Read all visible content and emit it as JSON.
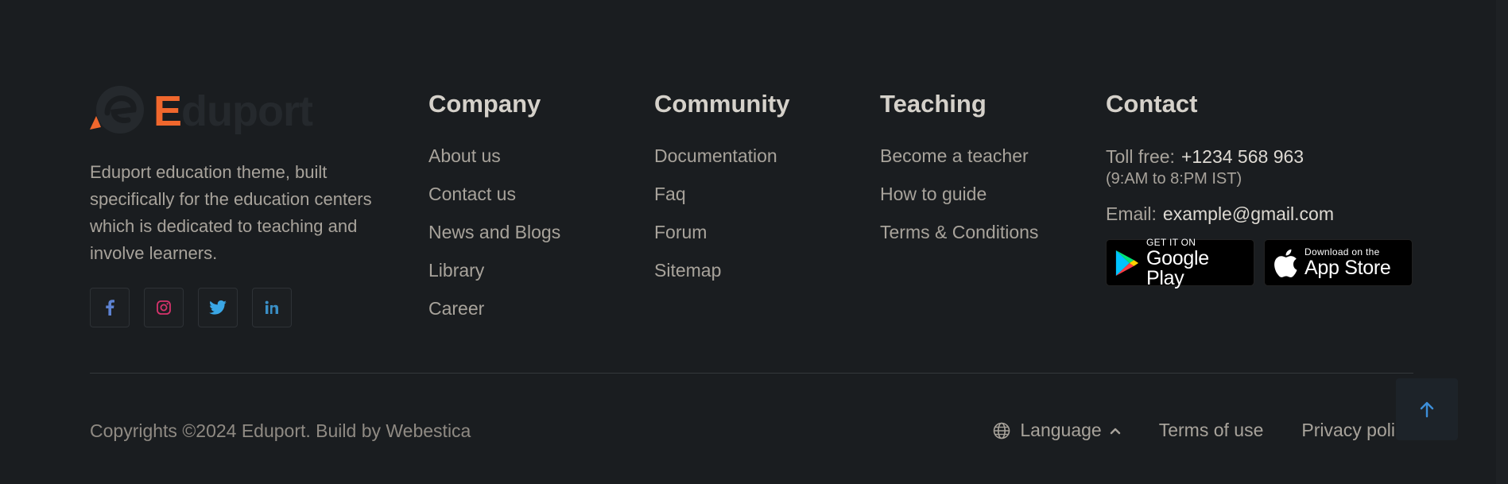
{
  "brand": {
    "logo_letter": "E",
    "logo_rest": "duport",
    "description": "Eduport education theme, built specifically for the education centers which is dedicated to teaching and involve learners.",
    "accent_color": "#f0672d"
  },
  "socials": [
    {
      "icon": "facebook-icon",
      "color": "#5d82d1"
    },
    {
      "icon": "instagram-icon",
      "color": "#d6336c"
    },
    {
      "icon": "twitter-icon",
      "color": "#3aa7e6"
    },
    {
      "icon": "linkedin-icon",
      "color": "#3a8fc6"
    }
  ],
  "company": {
    "title": "Company",
    "links": [
      "About us",
      "Contact us",
      "News and Blogs",
      "Library",
      "Career"
    ]
  },
  "community": {
    "title": "Community",
    "links": [
      "Documentation",
      "Faq",
      "Forum",
      "Sitemap"
    ]
  },
  "teaching": {
    "title": "Teaching",
    "links": [
      "Become a teacher",
      "How to guide",
      "Terms & Conditions"
    ]
  },
  "contact": {
    "title": "Contact",
    "toll_label": "Toll free:",
    "toll_value": "+1234 568 963",
    "hours": "(9:AM to 8:PM IST)",
    "email_label": "Email:",
    "email_value": "example@gmail.com",
    "google_small": "GET IT ON",
    "google_big": "Google Play",
    "apple_small": "Download on the",
    "apple_big": "App Store"
  },
  "bottom": {
    "copyright": "Copyrights ©2024 Eduport. Build by Webestica",
    "language": "Language",
    "terms": "Terms of use",
    "privacy": "Privacy policy"
  }
}
